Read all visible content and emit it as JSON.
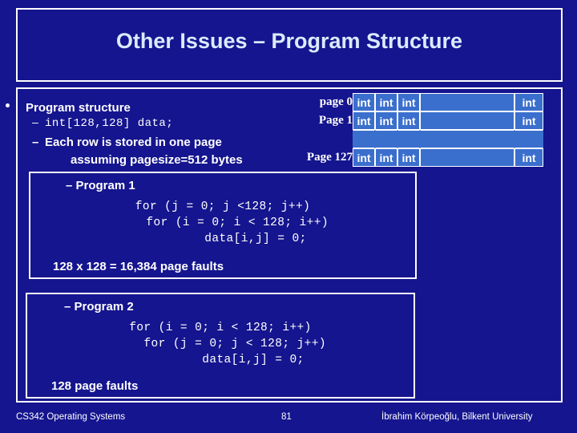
{
  "slide": {
    "title": "Other Issues – Program Structure",
    "background_color": "#15158f",
    "frame_color": "#ffffff",
    "text_color": "#ffffff",
    "title_color": "#dceaff",
    "cell_fill_color": "#3b6fcd"
  },
  "bullets": {
    "level1": "Program structure",
    "dash": "–",
    "declaration": "int[128,128] data;",
    "each_row": "Each row is stored in one page",
    "assuming": "assuming pagesize=512 bytes"
  },
  "page_table": {
    "rows": [
      {
        "label": "page 0",
        "cells": [
          "int",
          "int",
          "int",
          "",
          "int"
        ]
      },
      {
        "label": "Page 1",
        "cells": [
          "int",
          "int",
          "int",
          "",
          "int"
        ]
      },
      {
        "label": "",
        "cells": [
          "",
          "",
          "",
          "",
          ""
        ]
      },
      {
        "label": "Page 127",
        "cells": [
          "int",
          "int",
          "int",
          "",
          "int"
        ]
      }
    ]
  },
  "program1": {
    "title": "– Program 1",
    "code": "for (j = 0; j <128; j++)\n    for (i = 0; i < 128; i++)\n         data[i,j] = 0;",
    "faults": "128 x 128 = 16,384 page faults"
  },
  "program2": {
    "title": "– Program 2",
    "code": "for (i = 0; i < 128; i++)\n    for (j = 0; j < 128; j++)\n         data[i,j] = 0;",
    "faults": "128 page faults"
  },
  "footer": {
    "course": "CS342 Operating Systems",
    "page_number": "81",
    "author": "İbrahim Körpeoğlu, Bilkent University"
  }
}
